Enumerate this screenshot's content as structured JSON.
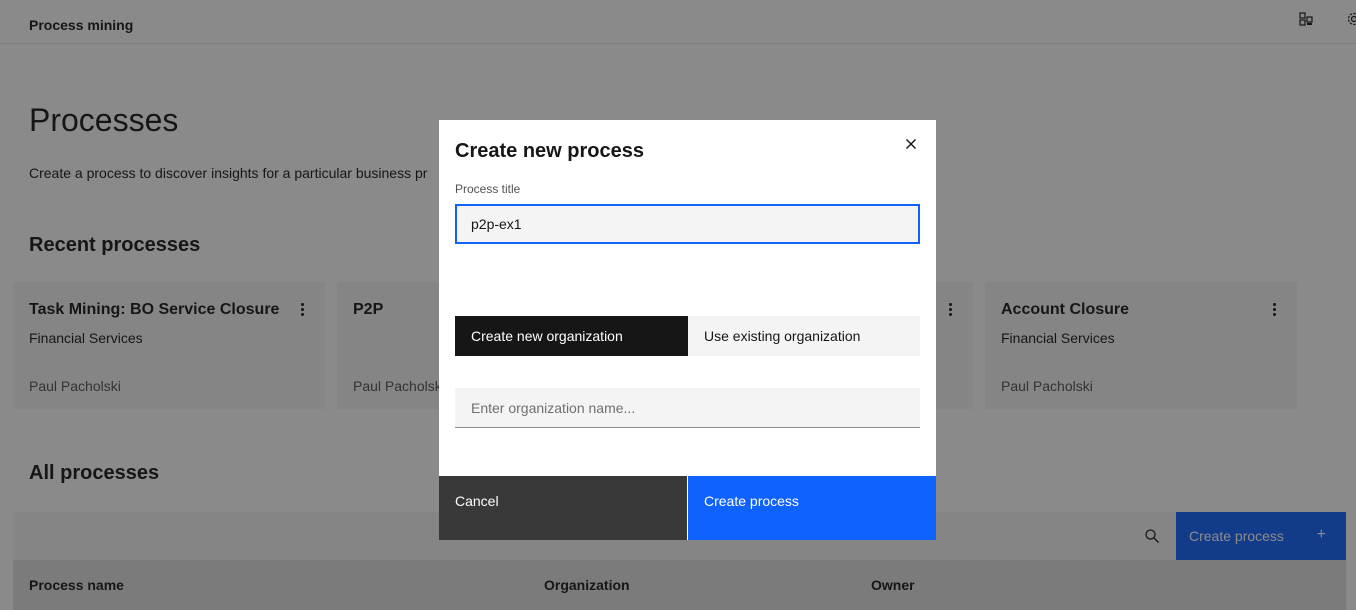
{
  "header": {
    "app_name": "Process mining",
    "icons": [
      "app-switcher-icon",
      "gear-icon"
    ]
  },
  "page": {
    "title": "Processes",
    "description": "Create a process to discover insights for a particular business pr"
  },
  "recent": {
    "title": "Recent processes",
    "cards": [
      {
        "title": "Task Mining: BO Service Closure",
        "org": "Financial Services",
        "owner": "Paul Pacholski"
      },
      {
        "title": "P2P",
        "org": "",
        "owner": "Paul Pacholsk"
      },
      {
        "title": "",
        "org": "",
        "owner": ""
      },
      {
        "title": "Account Closure",
        "org": "Financial Services",
        "owner": "Paul Pacholski"
      }
    ]
  },
  "all": {
    "title": "All processes",
    "create_button": "Create process",
    "columns": [
      "Process name",
      "Organization",
      "Owner"
    ]
  },
  "modal": {
    "title": "Create new process",
    "process_title_label": "Process title",
    "process_title_value": "p2p-ex1",
    "segments": [
      "Create new organization",
      "Use existing organization"
    ],
    "active_segment": "Create new organization",
    "org_placeholder": "Enter organization name...",
    "cancel_label": "Cancel",
    "create_label": "Create process"
  },
  "colors": {
    "primary": "#0f62fe",
    "dark": "#161616",
    "secondary_button": "#393939",
    "field_bg": "#f4f4f4"
  }
}
